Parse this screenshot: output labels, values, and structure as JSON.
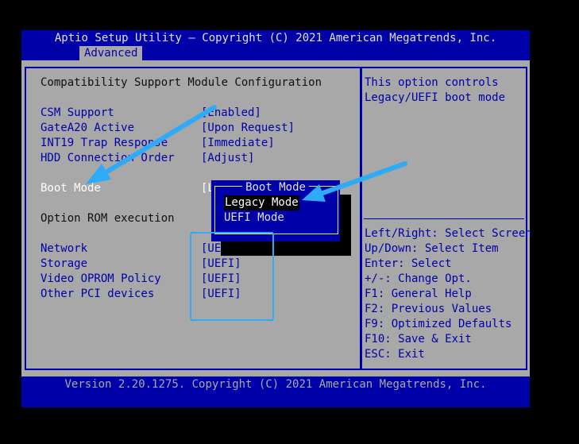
{
  "header": {
    "title": "Aptio Setup Utility – Copyright (C) 2021 American Megatrends, Inc.",
    "active_tab": "Advanced"
  },
  "main": {
    "section_title": "Compatibility Support Module Configuration",
    "settings": [
      {
        "label": "CSM Support",
        "value": "[Enabled]"
      },
      {
        "label": "GateA20 Active",
        "value": "[Upon Request]"
      },
      {
        "label": "INT19 Trap Response",
        "value": "[Immediate]"
      },
      {
        "label": "HDD Connection Order",
        "value": "[Adjust]"
      }
    ],
    "boot_mode": {
      "label": "Boot Mode",
      "value": "[L"
    },
    "option_rom_heading": "Option ROM execution",
    "option_rom": [
      {
        "label": "Network",
        "value": "[UEF"
      },
      {
        "label": "Storage",
        "value": "[UEFI]"
      },
      {
        "label": "Video OPROM Policy",
        "value": "[UEFI]"
      },
      {
        "label": "Other PCI devices",
        "value": "[UEFI]"
      }
    ]
  },
  "popup": {
    "title": "Boot Mode",
    "options": [
      "Legacy Mode",
      "UEFI Mode"
    ],
    "selected_index": 0
  },
  "help": {
    "description": [
      "This option controls",
      "Legacy/UEFI boot mode"
    ],
    "keys": [
      "Left/Right: Select Screen",
      "Up/Down: Select Item",
      "Enter: Select",
      "+/-: Change Opt.",
      "F1: General Help",
      "F2: Previous Values",
      "F9: Optimized Defaults",
      "F10: Save & Exit",
      "ESC: Exit"
    ]
  },
  "footer": {
    "text": "Version 2.20.1275. Copyright (C) 2021 American Megatrends, Inc."
  },
  "colors": {
    "bios_blue": "#0000a8",
    "bios_gray": "#a8a8a8",
    "annotation_cyan": "#2eaaf6"
  }
}
